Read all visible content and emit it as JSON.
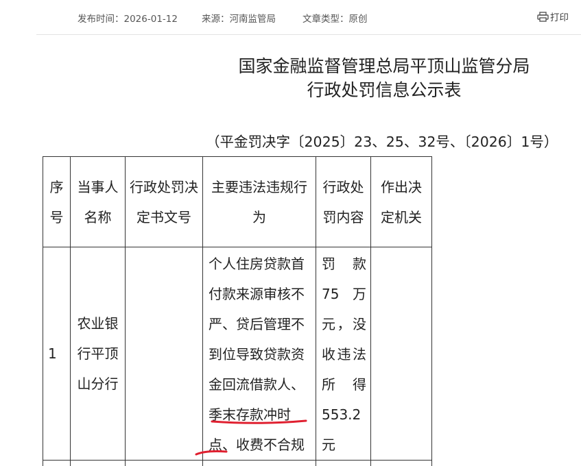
{
  "meta": {
    "publish_time": "发布时间：2026-01-12",
    "source": "来源：河南监管局",
    "article_type": "文章类型：原创",
    "print_label": "打印"
  },
  "title": {
    "line1": "国家金融监督管理总局平顶山监管分局",
    "line2": "行政处罚信息公示表"
  },
  "document_number": "（平金罚决字〔2025〕23、25、32号、〔2026〕1号）",
  "table": {
    "headers": [
      "序号",
      "当事人名称",
      "行政处罚决定书文号",
      "主要违法违规行为",
      "行政处罚内容",
      "作出决定机关"
    ],
    "rows": [
      {
        "index": "1",
        "party": "农业银行平顶山分行",
        "decision_no": "",
        "violation": "个人住房贷款首付款来源审核不严、贷后管理不到位导致贷款资金回流借款人、季末存款冲时点、收费不合规",
        "penalty": "罚款75万元，没收违法所得553.2元",
        "authority": ""
      }
    ]
  },
  "annotation_color": "#e02030"
}
